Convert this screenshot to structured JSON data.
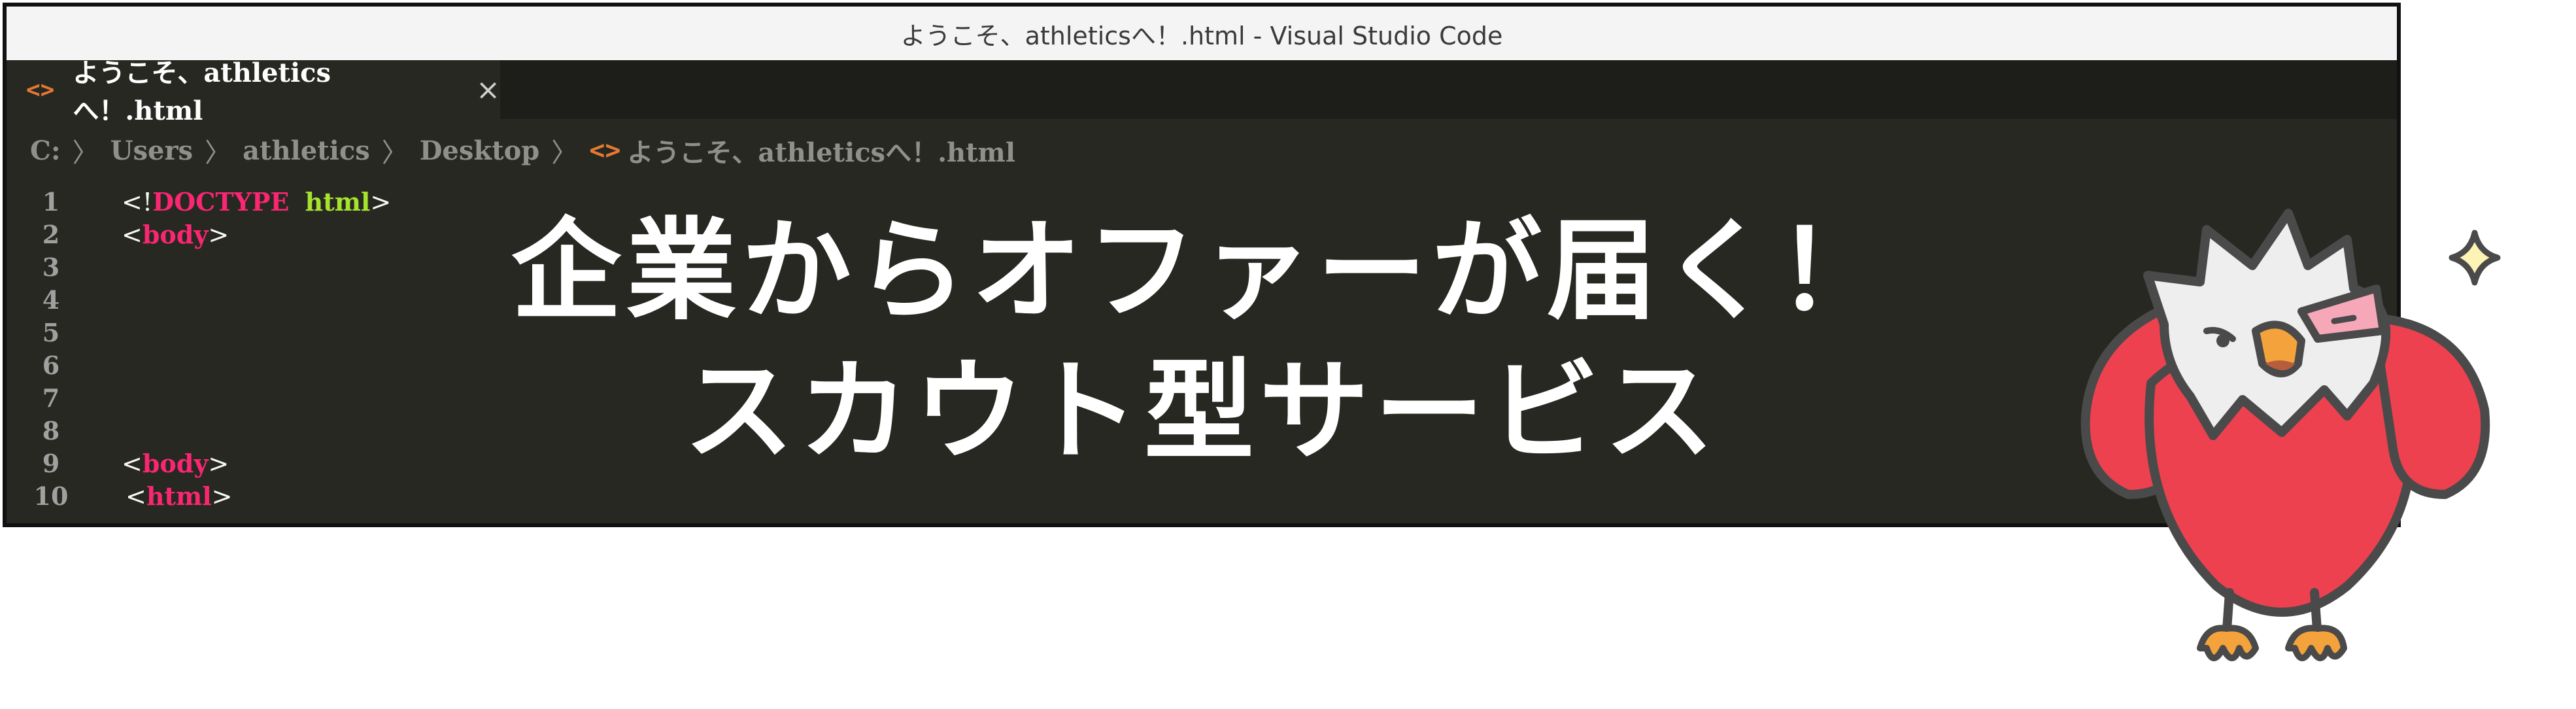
{
  "window": {
    "title": "ようこそ、athleticsへ！.html - Visual Studio Code"
  },
  "tab": {
    "icon": "<>",
    "label": "ようこそ、athleticsへ！.html",
    "close": "×"
  },
  "breadcrumb": {
    "items": [
      "C:",
      "Users",
      "athletics",
      "Desktop"
    ],
    "separator": "〉",
    "file_icon": "<>",
    "file": "ようこそ、athleticsへ！.html"
  },
  "editor": {
    "line_numbers": [
      "1",
      "2",
      "3",
      "4",
      "5",
      "6",
      "7",
      "8",
      "9",
      "10"
    ],
    "lines": {
      "l1": {
        "open": "<!",
        "keyword": "DOCTYPE",
        "attr": "html",
        "close": ">"
      },
      "l2": {
        "open": "<",
        "tag": "body",
        "close": ">"
      },
      "l9": {
        "open": "<",
        "tag": "body",
        "close": ">"
      },
      "l10": {
        "open": "<",
        "tag": "html",
        "close": ">"
      }
    }
  },
  "headline": {
    "line1": "企業からオファーが届く！",
    "line2": "スカウト型サービス"
  },
  "colors": {
    "editor_bg": "#272822",
    "keyword": "#f92672",
    "attribute": "#a6e22e",
    "file_icon": "#e37933",
    "mascot_red": "#ee4150",
    "mascot_beak": "#f4a23c"
  },
  "mascot": {
    "icon": "eagle-mascot-icon",
    "sparkle": "sparkle-icon"
  }
}
